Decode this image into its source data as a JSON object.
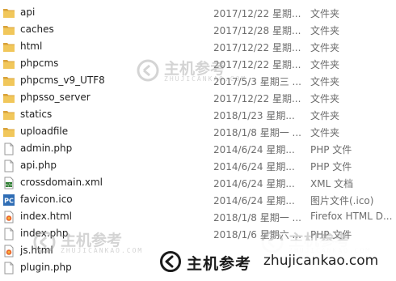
{
  "files": [
    {
      "name": "api",
      "date": "2017/12/22 星期...",
      "type": "文件夹",
      "icon": "folder-icon"
    },
    {
      "name": "caches",
      "date": "2017/12/28 星期...",
      "type": "文件夹",
      "icon": "folder-icon"
    },
    {
      "name": "html",
      "date": "2017/12/22 星期...",
      "type": "文件夹",
      "icon": "folder-icon"
    },
    {
      "name": "phpcms",
      "date": "2017/12/22 星期...",
      "type": "文件夹",
      "icon": "folder-icon"
    },
    {
      "name": "phpcms_v9_UTF8",
      "date": "2017/5/3 星期三 ...",
      "type": "文件夹",
      "icon": "folder-icon"
    },
    {
      "name": "phpsso_server",
      "date": "2017/12/22 星期...",
      "type": "文件夹",
      "icon": "folder-icon"
    },
    {
      "name": "statics",
      "date": "2018/1/23 星期...",
      "type": "文件夹",
      "icon": "folder-icon"
    },
    {
      "name": "uploadfile",
      "date": "2018/1/8 星期一 ...",
      "type": "文件夹",
      "icon": "folder-icon"
    },
    {
      "name": "admin.php",
      "date": "2014/6/24 星期...",
      "type": "PHP 文件",
      "icon": "php-file-icon"
    },
    {
      "name": "api.php",
      "date": "2014/6/24 星期...",
      "type": "PHP 文件",
      "icon": "php-file-icon"
    },
    {
      "name": "crossdomain.xml",
      "date": "2014/6/24 星期...",
      "type": "XML 文档",
      "icon": "xml-file-icon"
    },
    {
      "name": "favicon.ico",
      "date": "2014/6/24 星期...",
      "type": "图片文件(.ico)",
      "icon": "ico-file-icon"
    },
    {
      "name": "index.html",
      "date": "2018/1/8 星期一 ...",
      "type": "Firefox HTML D...",
      "icon": "html-file-icon"
    },
    {
      "name": "index.php",
      "date": "2018/1/6 星期六 ...",
      "type": "PHP 文件",
      "icon": "php-file-icon"
    },
    {
      "name": "js.html",
      "date": "",
      "type": "",
      "icon": "html-file-icon"
    },
    {
      "name": "plugin.php",
      "date": "",
      "type": "",
      "icon": "php-file-icon"
    }
  ],
  "watermark": {
    "brand_cn": "主机参考",
    "url": "zhujicankao.com",
    "ghost_cn": "主机参考",
    "ghost_sub": "ZHUJICANKAO.COM"
  },
  "colors": {
    "folder": "#e8b94a",
    "folder_dark": "#d9a23a",
    "secondary_text": "#6d6d6d",
    "primary_text": "#1f1f1f"
  }
}
